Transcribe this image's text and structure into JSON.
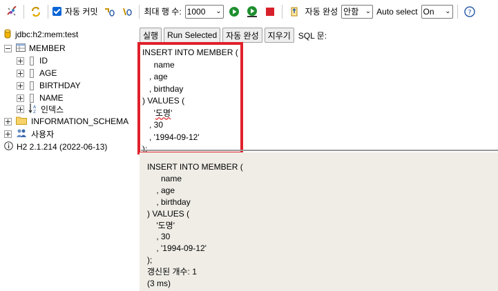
{
  "toolbar": {
    "autocommit_label": "자동 커밋",
    "maxrows_label": "최대 행 수:",
    "maxrows_value": "1000",
    "autocomplete_label": "자동 완성",
    "autocomplete_value": "안함",
    "autoselect_label": "Auto select",
    "autoselect_value": "On",
    "help_glyph": "?",
    "icons": [
      "disconnect-icon",
      "refresh-icon",
      "rollback-icon",
      "commit-icon",
      "run-icon",
      "run-selected-icon",
      "stop-icon",
      "history-icon",
      "help-icon"
    ]
  },
  "tree": {
    "connection": "jdbc:h2:mem:test",
    "table": "MEMBER",
    "columns": [
      "ID",
      "AGE",
      "BIRTHDAY",
      "NAME"
    ],
    "indexes": "인덱스",
    "schema": "INFORMATION_SCHEMA",
    "users": "사용자",
    "version": "H2 2.1.214 (2022-06-13)"
  },
  "buttons": {
    "run": "실행",
    "run_selected": "Run Selected",
    "autocomplete": "자동 완성",
    "clear": "지우기",
    "sql_label": "SQL 문:"
  },
  "editor": {
    "line1": "INSERT INTO MEMBER (",
    "line2": "     name",
    "line3": "   , age",
    "line4": "   , birthday",
    "line5": ") VALUES (",
    "line6_a": "     '",
    "line6_b": "도명",
    "line6_c": "'",
    "line7": "   , 30",
    "line8": "   , '1994-09-12'",
    "line9": ");"
  },
  "result": {
    "text": "INSERT INTO MEMBER (\n      name\n    , age\n    , birthday\n) VALUES (\n    '도명'\n    , 30\n    , '1994-09-12'\n);\n갱신된 개수: 1\n(3 ms)"
  },
  "colors": {
    "highlight_border": "#e0212b",
    "result_background": "#efede6",
    "checkbox_accent": "#0a64d8"
  }
}
